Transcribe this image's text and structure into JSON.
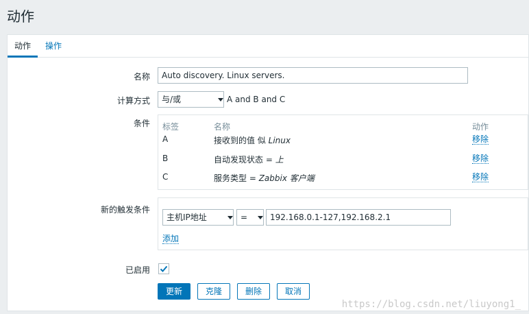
{
  "page": {
    "title": "动作"
  },
  "tabs": [
    {
      "label": "动作"
    },
    {
      "label": "操作"
    }
  ],
  "form": {
    "name_label": "名称",
    "name_value": "Auto discovery. Linux servers.",
    "calc_label": "计算方式",
    "calc_value": "与/或",
    "calc_expression": "A and B and C",
    "conditions_label": "条件",
    "conditions_headers": {
      "tag": "标签",
      "name": "名称",
      "action": "动作"
    },
    "conditions": [
      {
        "tag": "A",
        "name_prefix": "接收到的值 似 ",
        "name_italic": "Linux",
        "action": "移除"
      },
      {
        "tag": "B",
        "name_prefix": "自动发现状态 = ",
        "name_italic": "上",
        "action": "移除"
      },
      {
        "tag": "C",
        "name_prefix": "服务类型 = ",
        "name_italic": "Zabbix 客户端",
        "action": "移除"
      }
    ],
    "new_condition_label": "新的触发条件",
    "new_condition_type": "主机IP地址",
    "new_condition_operator": "=",
    "new_condition_value": "192.168.0.1-127,192.168.2.1",
    "add_label": "添加",
    "enabled_label": "已启用",
    "enabled": true
  },
  "buttons": {
    "update": "更新",
    "clone": "克隆",
    "delete": "删除",
    "cancel": "取消"
  },
  "watermark": "https://blog.csdn.net/liuyong1_",
  "colors": {
    "accent": "#0275b8",
    "background": "#ebeef0"
  }
}
